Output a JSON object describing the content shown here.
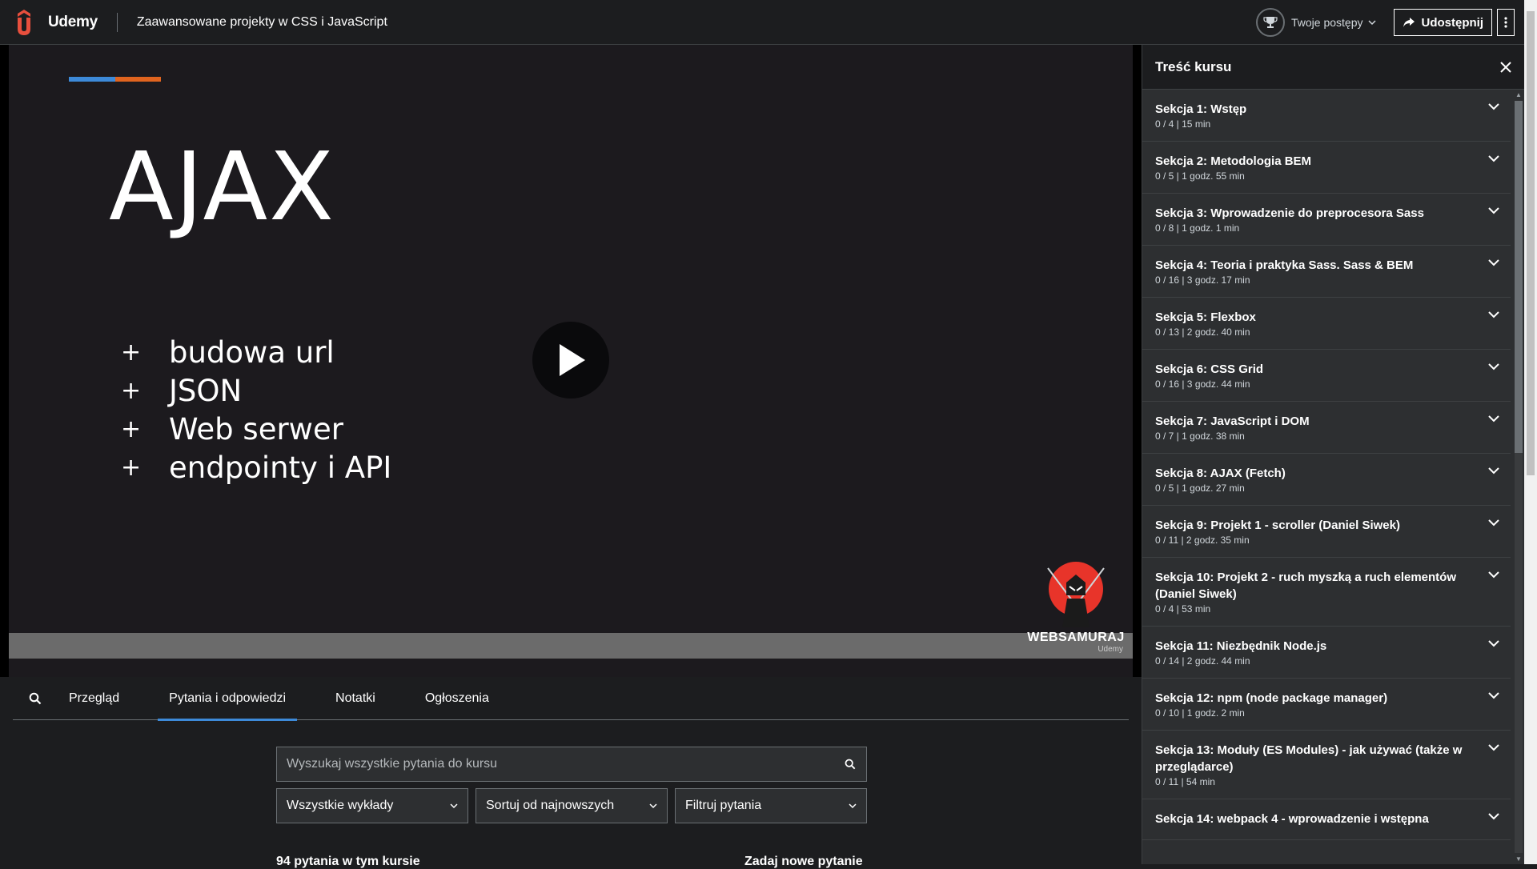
{
  "header": {
    "brand": "Udemy",
    "course_title": "Zaawansowane projekty w CSS i JavaScript",
    "progress_label": "Twoje postępy",
    "share_label": "Udostępnij"
  },
  "slide": {
    "title": "AJAX",
    "bullets": [
      {
        "symbol": "+",
        "text": "budowa url"
      },
      {
        "symbol": "+",
        "text": "JSON"
      },
      {
        "symbol": "+",
        "text": "Web serwer"
      },
      {
        "symbol": "+",
        "text": "endpointy i API"
      }
    ],
    "watermark": "WEBSAMURAJ",
    "watermark_sub": "Udemy"
  },
  "tabs": [
    {
      "label": "Przegląd",
      "active": false
    },
    {
      "label": "Pytania i odpowiedzi",
      "active": true
    },
    {
      "label": "Notatki",
      "active": false
    },
    {
      "label": "Ogłoszenia",
      "active": false
    }
  ],
  "qa": {
    "search_placeholder": "Wyszukaj wszystkie pytania do kursu",
    "filters": [
      "Wszystkie wykłady",
      "Sortuj od najnowszych",
      "Filtruj pytania"
    ],
    "count_label": "94 pytania w tym kursie",
    "ask_label": "Zadaj nowe pytanie"
  },
  "sidebar": {
    "title": "Treść kursu",
    "sections": [
      {
        "name": "Sekcja 1: Wstęp",
        "meta": "0 / 4  |  15 min"
      },
      {
        "name": "Sekcja 2: Metodologia BEM",
        "meta": "0 / 5  |  1 godz. 55 min"
      },
      {
        "name": "Sekcja 3: Wprowadzenie do preprocesora Sass",
        "meta": "0 / 8  |  1 godz. 1 min"
      },
      {
        "name": "Sekcja 4: Teoria i praktyka Sass. Sass & BEM",
        "meta": "0 / 16  |  3 godz. 17 min"
      },
      {
        "name": "Sekcja 5: Flexbox",
        "meta": "0 / 13  |  2 godz. 40 min"
      },
      {
        "name": "Sekcja 6: CSS Grid",
        "meta": "0 / 16  |  3 godz. 44 min"
      },
      {
        "name": "Sekcja 7: JavaScript i DOM",
        "meta": "0 / 7  |  1 godz. 38 min"
      },
      {
        "name": "Sekcja 8: AJAX (Fetch)",
        "meta": "0 / 5  |  1 godz. 27 min"
      },
      {
        "name": "Sekcja 9: Projekt 1 - scroller (Daniel Siwek)",
        "meta": "0 / 11  |  2 godz. 35 min"
      },
      {
        "name": "Sekcja 10: Projekt 2 - ruch myszką a ruch elementów (Daniel Siwek)",
        "meta": "0 / 4  |  53 min"
      },
      {
        "name": "Sekcja 11: Niezbędnik Node.js",
        "meta": "0 / 14  |  2 godz. 44 min"
      },
      {
        "name": "Sekcja 12: npm (node package manager)",
        "meta": "0 / 10  |  1 godz. 2 min"
      },
      {
        "name": "Sekcja 13: Moduły (ES Modules) - jak używać (także w przeglądarce)",
        "meta": "0 / 11  |  54 min"
      },
      {
        "name": "Sekcja 14: webpack 4 - wprowadzenie i wstępna",
        "meta": ""
      }
    ]
  },
  "colors": {
    "accent_blue": "#3d8ad9",
    "accent_orange": "#e0641f",
    "brand": "#a435f0"
  }
}
